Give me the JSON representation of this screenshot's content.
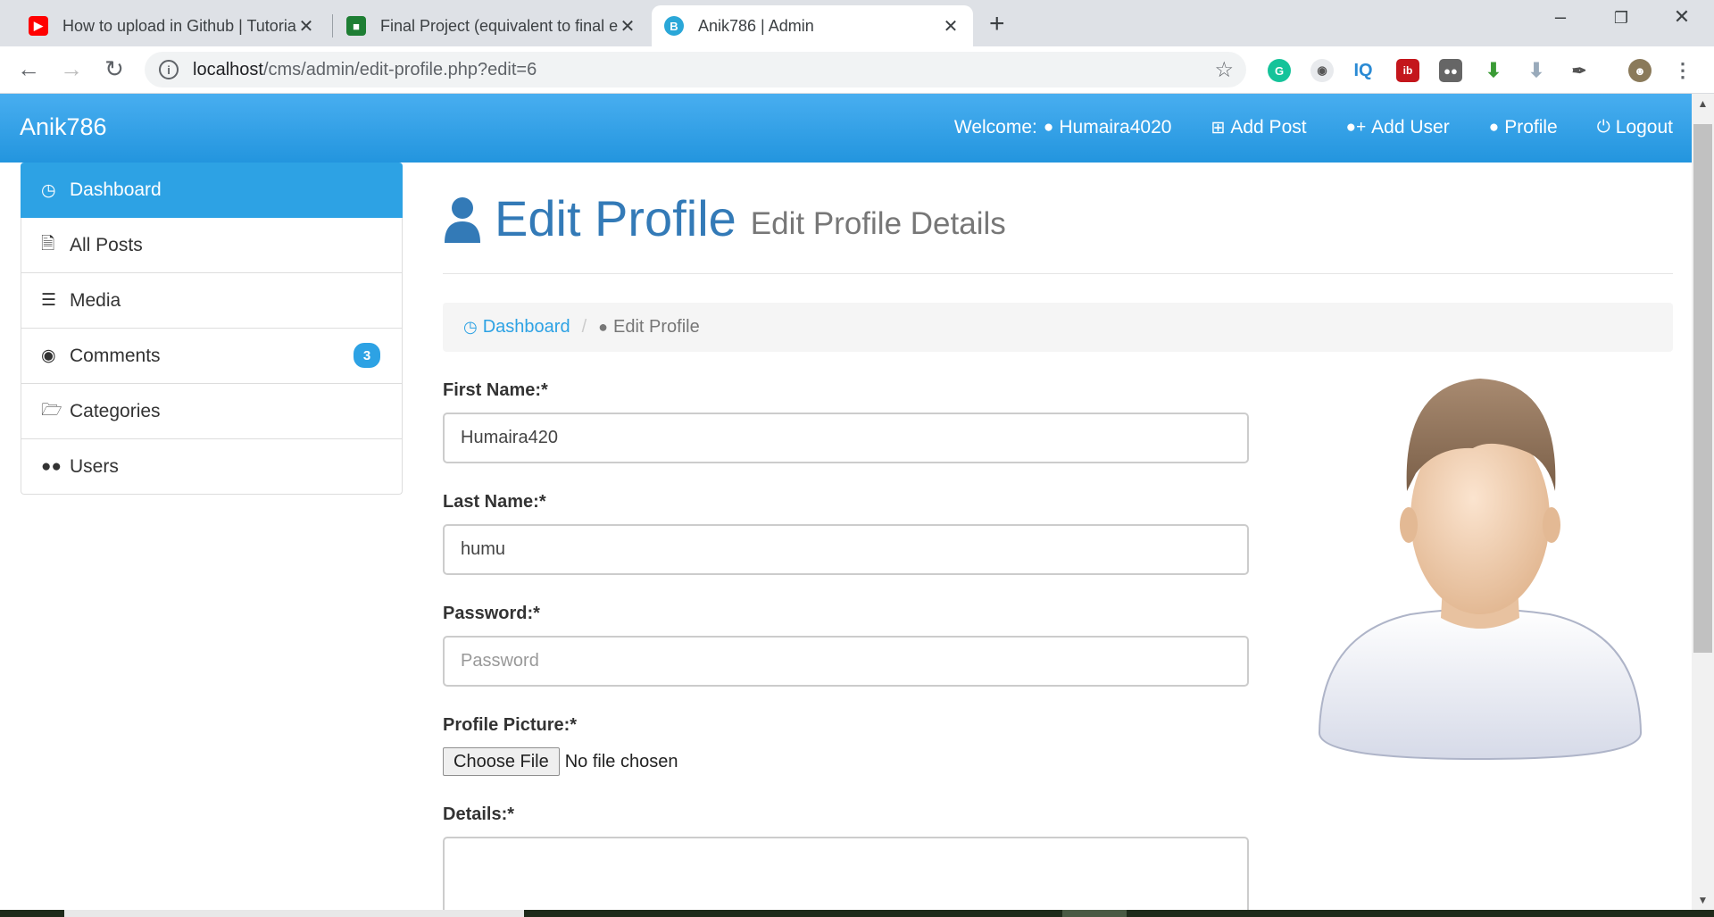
{
  "browser": {
    "tabs": [
      {
        "title": "How to upload in Github | Tutorial",
        "favicon": "youtube-icon"
      },
      {
        "title": "Final Project (equivalent to final exam)",
        "favicon": "classroom-icon"
      },
      {
        "title": "Anik786 | Admin",
        "favicon": "bootstrap-icon"
      }
    ],
    "url_host": "localhost",
    "url_path": "/cms/admin/edit-profile.php?edit=6",
    "extensions": [
      "grammarly-icon",
      "eye-extension-icon",
      "iq-extension-icon",
      "ib-extension-icon",
      "tampermonkey-icon",
      "download-manager-icon",
      "download-arrow-icon",
      "eyedropper-icon",
      "profile-avatar-icon",
      "menu-dots-icon"
    ]
  },
  "navbar": {
    "brand": "Anik786",
    "welcome_prefix": "Welcome:",
    "username": "Humaira4020",
    "add_post": "Add Post",
    "add_user": "Add User",
    "profile": "Profile",
    "logout": "Logout",
    "color": "#2da2e4"
  },
  "sidebar": {
    "items": [
      {
        "label": "Dashboard",
        "icon": "dashboard-icon",
        "active": true
      },
      {
        "label": "All Posts",
        "icon": "file-icon"
      },
      {
        "label": "Media",
        "icon": "database-icon"
      },
      {
        "label": "Comments",
        "icon": "comment-icon",
        "badge": "3"
      },
      {
        "label": "Categories",
        "icon": "folder-open-icon"
      },
      {
        "label": "Users",
        "icon": "users-icon"
      }
    ]
  },
  "page": {
    "title": "Edit Profile",
    "subtitle": "Edit Profile Details",
    "breadcrumb": {
      "link": "Dashboard",
      "current": "Edit Profile"
    }
  },
  "form": {
    "first_name_label": "First Name:*",
    "first_name_value": "Humaira420",
    "last_name_label": "Last Name:*",
    "last_name_value": "humu",
    "password_label": "Password:*",
    "password_placeholder": "Password",
    "picture_label": "Profile Picture:*",
    "choose_file": "Choose File",
    "no_file": "No file chosen",
    "details_label": "Details:*"
  }
}
